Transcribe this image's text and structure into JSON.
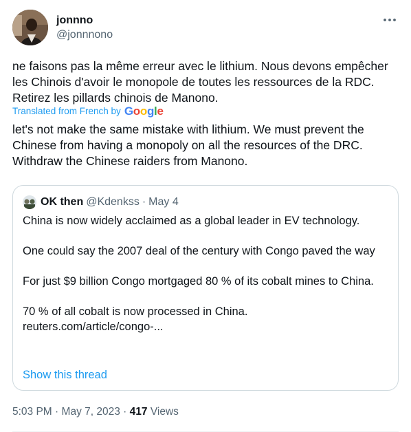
{
  "author": {
    "name": "jonnno",
    "handle": "@jonnnono"
  },
  "tweet": {
    "original_text": "ne faisons pas la même erreur avec le lithium. Nous devons empêcher les Chinois d'avoir le monopole de toutes les ressources de la RDC. Retirez les pillards chinois de Manono.",
    "translated_by_label": "Translated from French by",
    "translation_brand": [
      "G",
      "o",
      "o",
      "g",
      "l",
      "e"
    ],
    "translated_text": "let's not make the same mistake with lithium. We must prevent the Chinese from having a monopoly on all the resources of the DRC. Withdraw the Chinese raiders from Manono."
  },
  "quote": {
    "name": "OK then",
    "handle": "@Kdenkss",
    "separator": "·",
    "date": "May 4",
    "lines": [
      "China is now widely acclaimed as a global leader in EV technology.",
      "One could say the 2007 deal of the century with Congo paved the way",
      "For just $9 billion Congo mortgaged 80 % of its cobalt mines to China.",
      "70 % of all cobalt is now processed in China.",
      "reuters.com/article/congo-..."
    ],
    "show_thread": "Show this thread"
  },
  "meta": {
    "time": "5:03 PM",
    "separator": "·",
    "date": "May 7, 2023",
    "views_count": "417",
    "views_label": "Views"
  },
  "colors": {
    "link": "#1d9bf0",
    "secondary_text": "#536471",
    "border": "#cfd9de"
  },
  "icons": {
    "more": "more-horizontal-icon"
  }
}
